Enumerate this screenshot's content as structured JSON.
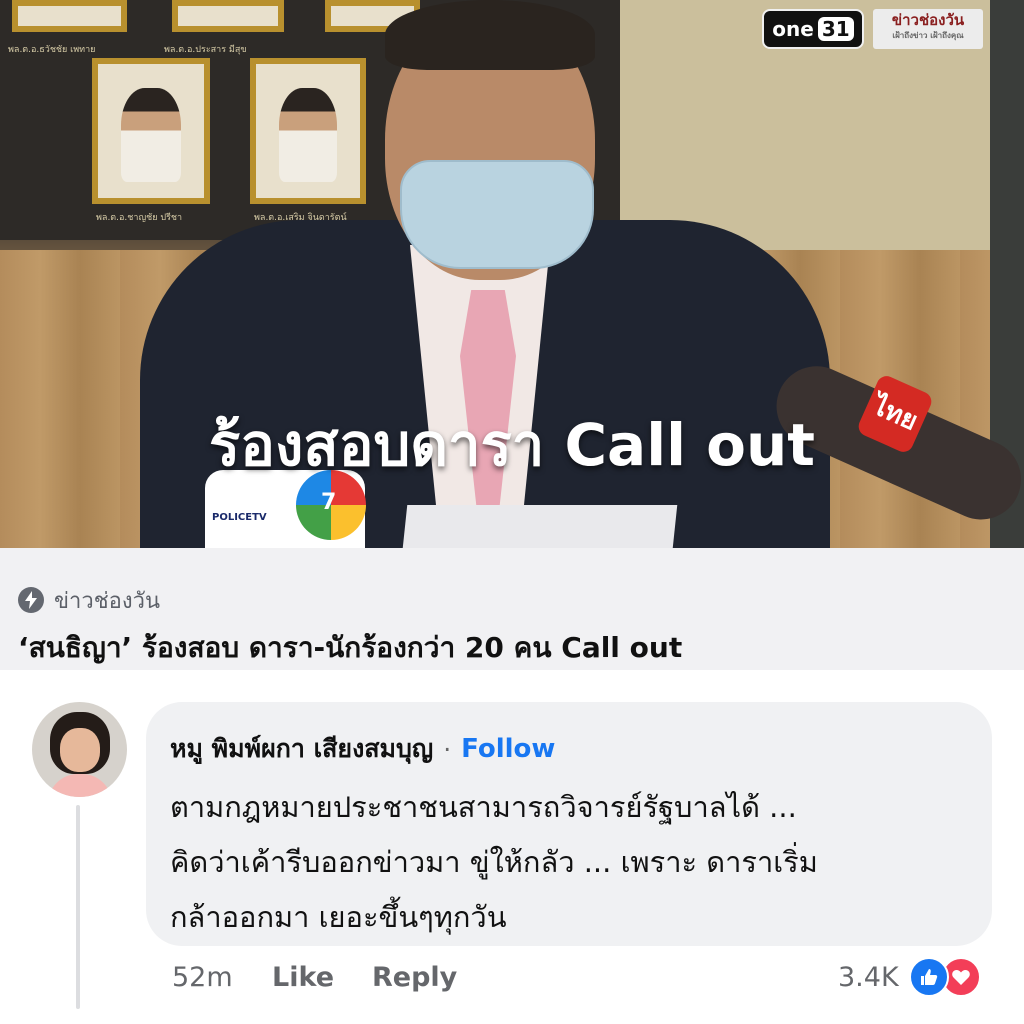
{
  "media": {
    "overlay_text": "ร้องสอบดารา Call out",
    "channel_logo": "one 31",
    "channel_logo_text": "one",
    "channel_logo_num": "31",
    "news_logo": "ข่าวช่องวัน",
    "news_logo_sub": "เฝ้าถึงข่าว เฝ้าถึงคุณ",
    "mic_left_label": "POLICETV",
    "mic_right_label": "ไทย",
    "mic_seven": "7",
    "frame_labels": [
      "พล.ต.อ.ธวัชชัย เพทาย",
      "พล.ต.อ.ประสาร มีสุข",
      "พล.ต.อ.ชาญชัย ปรีชา",
      "พล.ต.อ.เสริม จินดารัตน์"
    ]
  },
  "link_preview": {
    "source_icon": "bolt-icon",
    "source_name": "ข่าวช่องวัน",
    "headline": "‘สนธิญา’ ร้องสอบ ดารา-นักร้องกว่า 20 คน Call out"
  },
  "comment": {
    "author": "หมู พิมพ์ผกา เสียงสมบุญ",
    "separator": "·",
    "follow_label": "Follow",
    "text": "ตามกฎหมายประชาชนสามารถวิจารย์รัฐบาลได้ ...\nคิดว่าเค้ารีบออกข่าวมา ขู่ให้กลัว  ... เพราะ ดาราเริ่ม\nกล้าออกมา เยอะขึ้นๆทุกวัน",
    "time": "52m",
    "like_label": "Like",
    "reply_label": "Reply",
    "reaction_count": "3.4K",
    "reaction_icons": [
      "like-icon",
      "love-icon"
    ]
  },
  "colors": {
    "accent": "#1877f2",
    "love": "#f33e58",
    "bubble": "#f0f1f3",
    "muted_text": "#65676b"
  }
}
